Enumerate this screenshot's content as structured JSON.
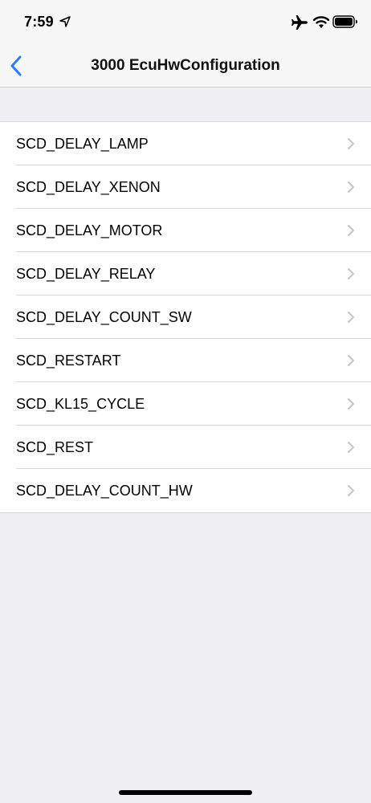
{
  "status_bar": {
    "time": "7:59",
    "icons": [
      "location-arrow-icon",
      "airplane-icon",
      "wifi-icon",
      "battery-icon"
    ]
  },
  "nav": {
    "title": "3000 EcuHwConfiguration",
    "back_icon": "chevron-left-icon",
    "accent_color": "#2e7cf6"
  },
  "list": {
    "items": [
      {
        "label": "SCD_DELAY_LAMP"
      },
      {
        "label": "SCD_DELAY_XENON"
      },
      {
        "label": "SCD_DELAY_MOTOR"
      },
      {
        "label": "SCD_DELAY_RELAY"
      },
      {
        "label": "SCD_DELAY_COUNT_SW"
      },
      {
        "label": "SCD_RESTART"
      },
      {
        "label": "SCD_KL15_CYCLE"
      },
      {
        "label": "SCD_REST"
      },
      {
        "label": "SCD_DELAY_COUNT_HW"
      }
    ]
  }
}
